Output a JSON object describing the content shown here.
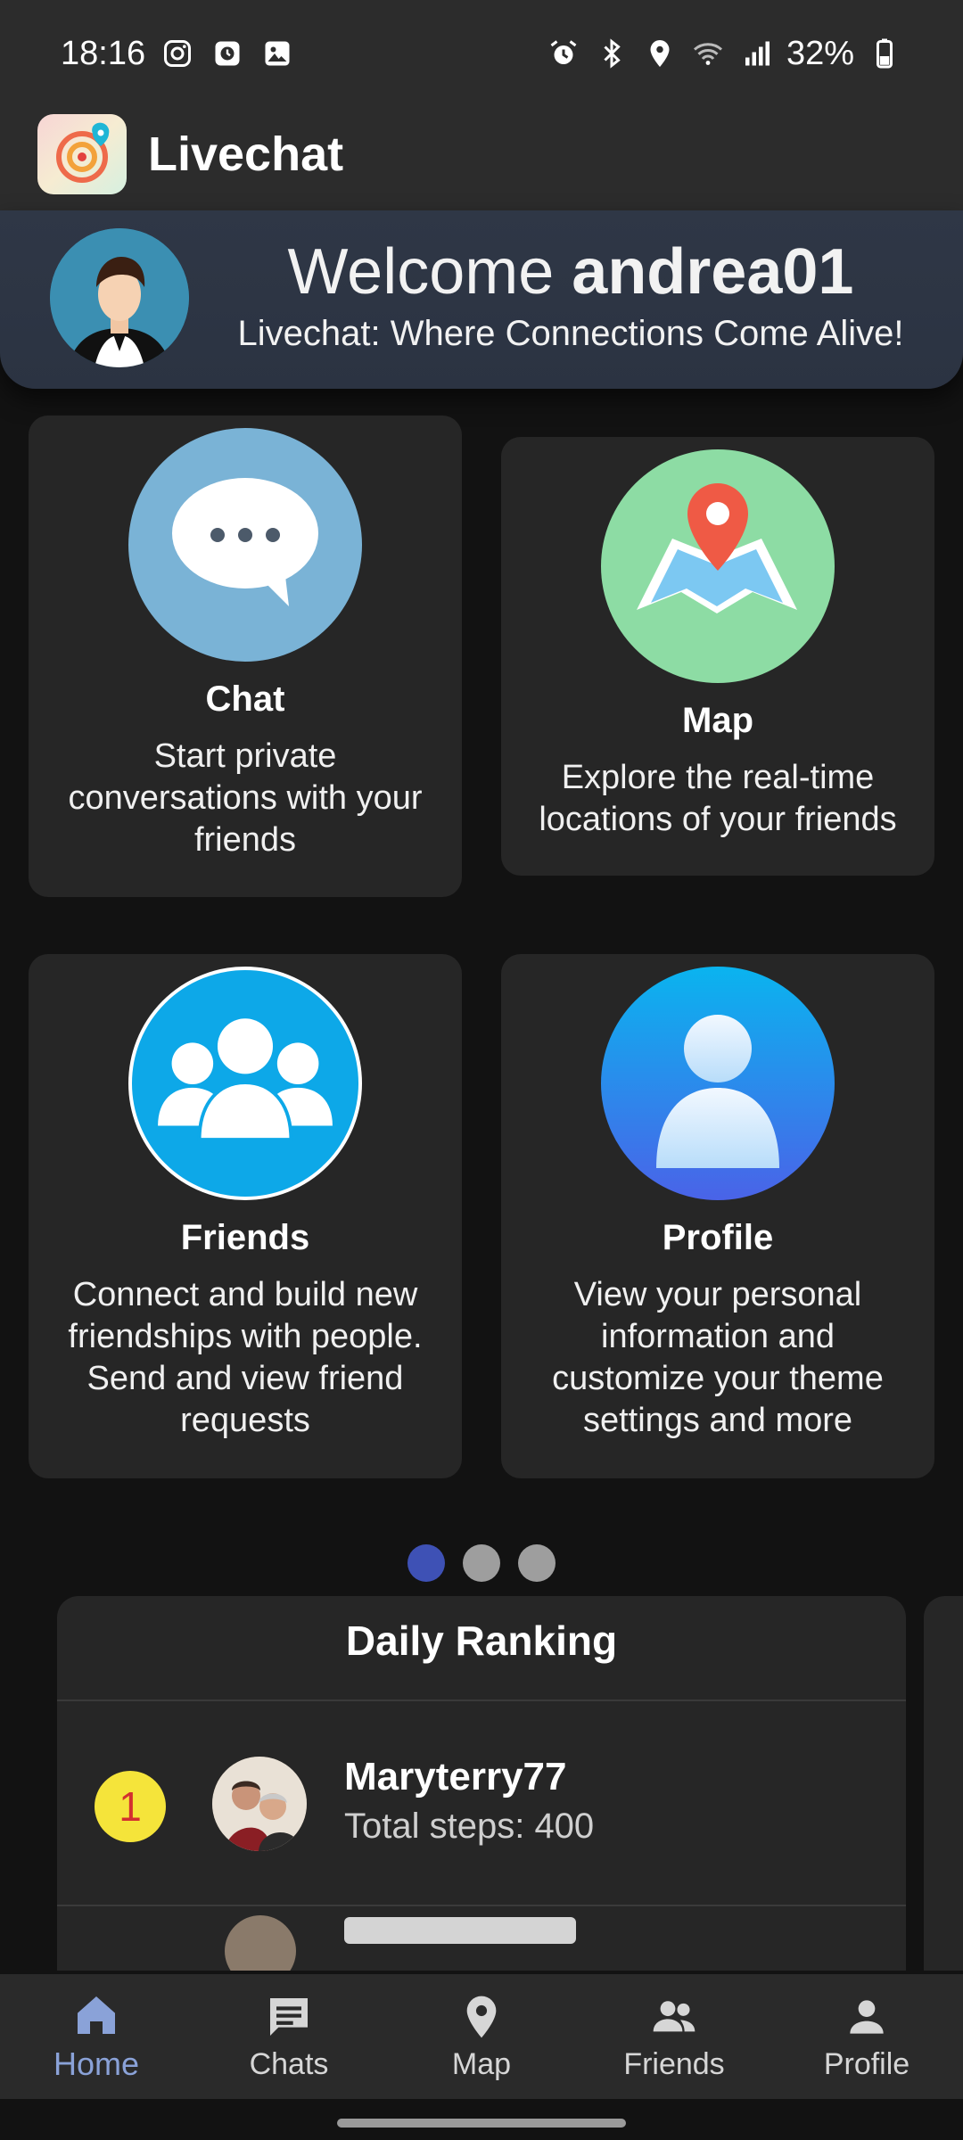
{
  "status_bar": {
    "time": "18:16",
    "battery": "32%",
    "left_icons": [
      "instagram-icon",
      "clock-app-icon",
      "gallery-icon"
    ],
    "right_icons": [
      "alarm-icon",
      "bluetooth-icon",
      "location-icon",
      "wifi-icon",
      "signal-icon",
      "battery-icon"
    ]
  },
  "app_bar": {
    "title": "Livechat"
  },
  "welcome": {
    "greeting": "Welcome ",
    "username": "andrea01",
    "tagline": "Livechat: Where Connections Come Alive!"
  },
  "features": {
    "chat": {
      "title": "Chat",
      "description": "Start private conversations with your friends",
      "color": "#7ab3d6"
    },
    "map": {
      "title": "Map",
      "description": "Explore the real-time locations of your friends",
      "color": "#8ddca4"
    },
    "friends": {
      "title": "Friends",
      "description": "Connect and build new friendships with people. Send and view friend requests",
      "color": "#0da8e8"
    },
    "profile": {
      "title": "Profile",
      "description": "View your personal information and customize your theme settings and more",
      "color": "#2a8cf0"
    }
  },
  "pager": {
    "total": 3,
    "active": 1
  },
  "ranking": {
    "title": "Daily Ranking",
    "entries": [
      {
        "rank": "1",
        "name": "Maryterry77",
        "steps": "Total steps: 400"
      }
    ]
  },
  "bottom_nav": {
    "items": [
      {
        "label": "Home",
        "icon": "home-icon",
        "active": true
      },
      {
        "label": "Chats",
        "icon": "chat-bubble-icon",
        "active": false
      },
      {
        "label": "Map",
        "icon": "location-pin-icon",
        "active": false
      },
      {
        "label": "Friends",
        "icon": "people-icon",
        "active": false
      },
      {
        "label": "Profile",
        "icon": "person-icon",
        "active": false
      }
    ]
  },
  "colors": {
    "background": "#121212",
    "surface": "#262626",
    "accent": "#3e51b5",
    "nav_active": "#8aa2d8",
    "rank_badge": "#f5e43a"
  }
}
